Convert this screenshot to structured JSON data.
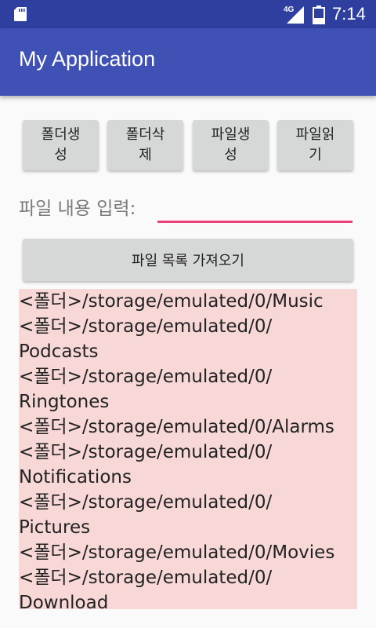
{
  "status_bar": {
    "network": "4G",
    "time": "7:14",
    "icons": [
      "sd-card-icon",
      "signal-icon",
      "battery-icon"
    ]
  },
  "app_bar": {
    "title": "My Application"
  },
  "buttons": {
    "create_folder": "폴더생성",
    "delete_folder": "폴더삭제",
    "create_file": "파일생성",
    "read_file": "파일읽기"
  },
  "input": {
    "label": "파일 내용 입력:",
    "value": ""
  },
  "list_button": {
    "label": "파일 목록 가져오기"
  },
  "file_list": {
    "lines": [
      "<폴더>/storage/emulated/0/Music",
      "<폴더>/storage/emulated/0/",
      "Podcasts",
      "<폴더>/storage/emulated/0/",
      "Ringtones",
      "<폴더>/storage/emulated/0/Alarms",
      "<폴더>/storage/emulated/0/",
      "Notifications",
      "<폴더>/storage/emulated/0/",
      "Pictures",
      "<폴더>/storage/emulated/0/Movies",
      "<폴더>/storage/emulated/0/",
      "Download"
    ]
  },
  "colors": {
    "status_bar": "#2f3fa0",
    "app_bar": "#3f51b5",
    "accent": "#ec407a",
    "list_background": "#f8d7d7",
    "button": "#d6d7d7"
  }
}
